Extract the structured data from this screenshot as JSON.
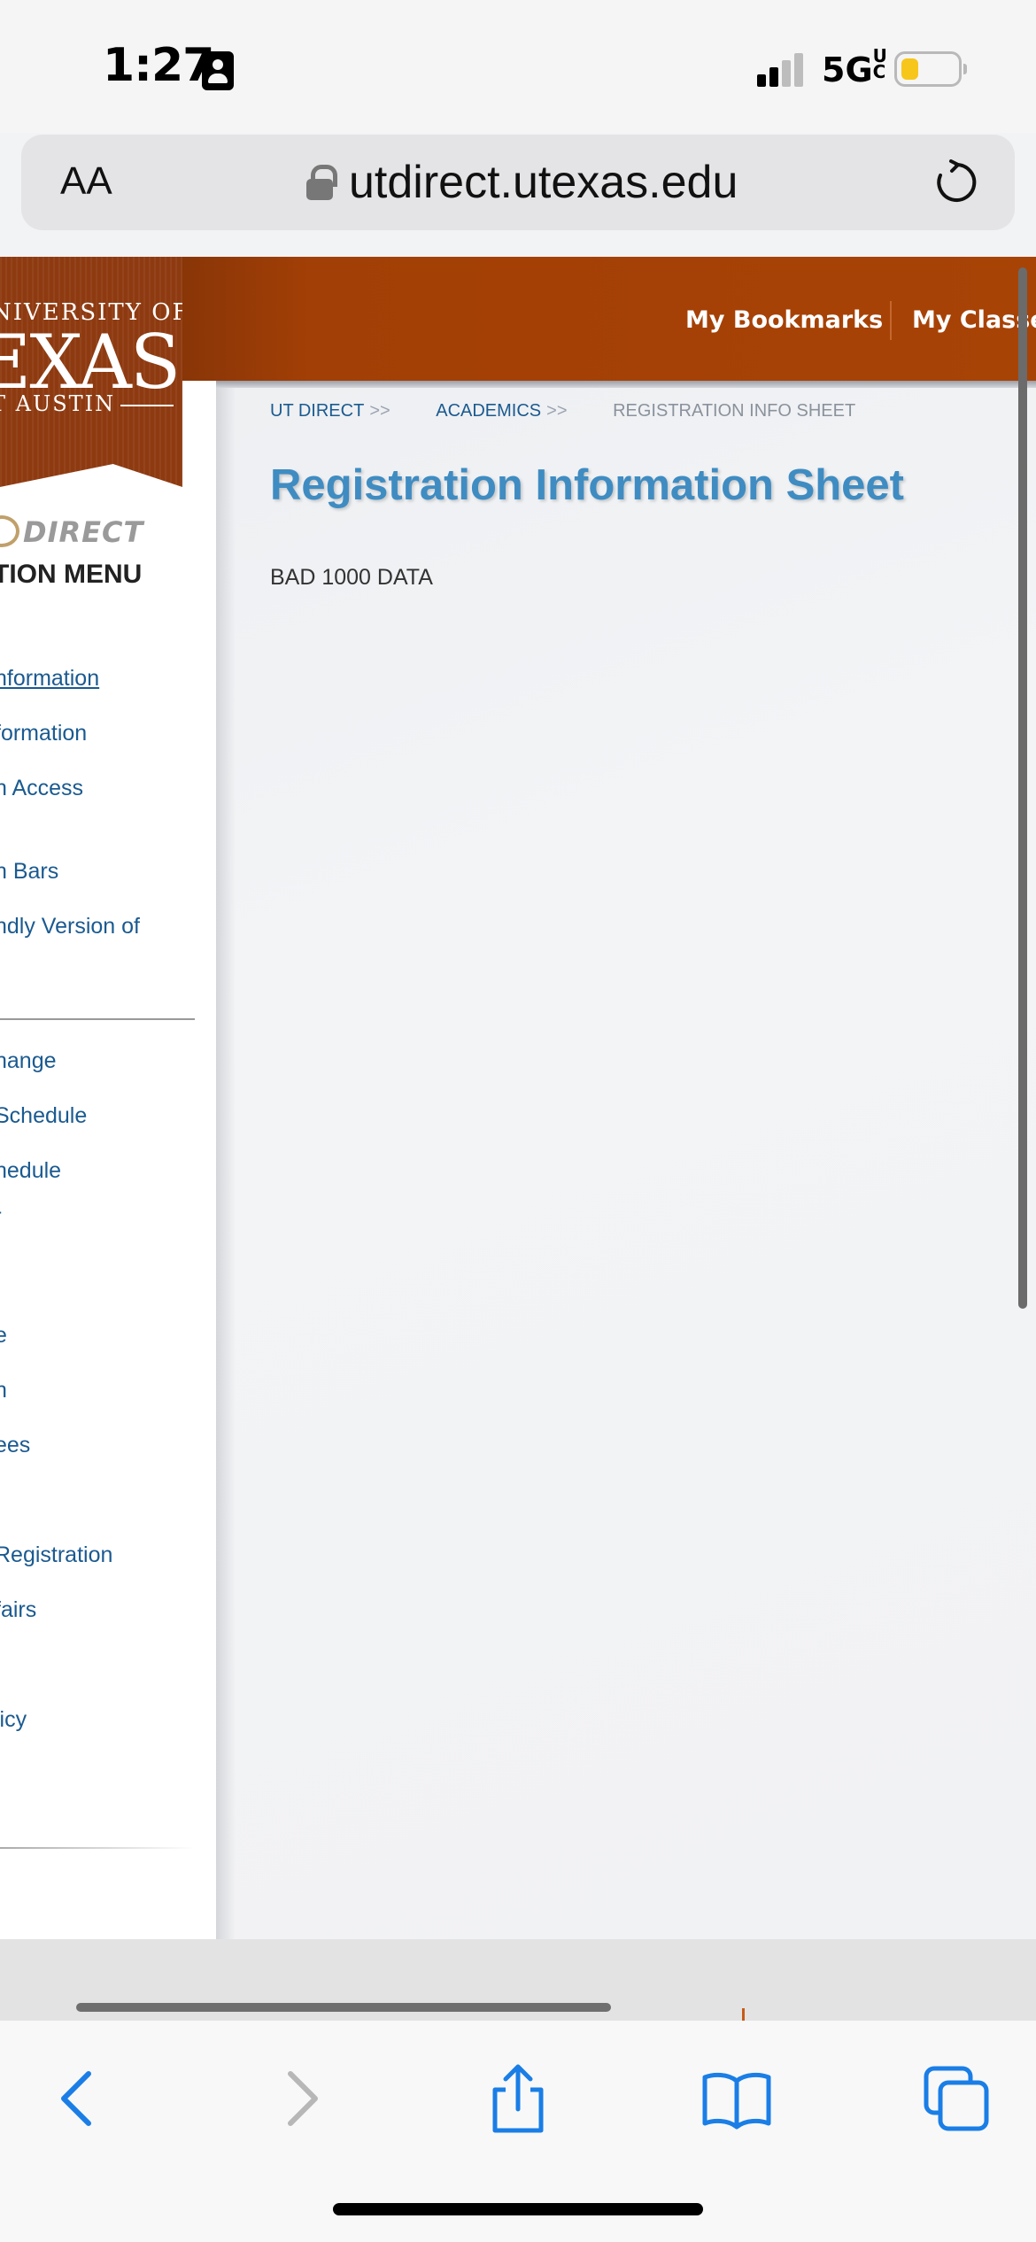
{
  "status_bar": {
    "time": "1:27",
    "network": "5G",
    "network_suffix": "UC",
    "battery_level": 0.3,
    "battery_color": "#f7c61a"
  },
  "browser": {
    "text_size_label": "AA",
    "url": "utdirect.utexas.edu",
    "icons": {
      "lock": "lock-icon",
      "reload": "reload-icon",
      "back": "back-chevron-icon",
      "forward": "forward-chevron-icon",
      "share": "share-icon",
      "bookmarks": "bookmarks-book-icon",
      "tabs": "tabs-icon"
    },
    "accent": "#1a7ee6"
  },
  "header": {
    "logo": {
      "line1": "NIVERSITY OF",
      "line2": "EXAS",
      "line3": "T AUSTIN"
    },
    "nav": [
      "My Bookmarks",
      "My Classe"
    ],
    "brand_color": "#a84306"
  },
  "sidebar": {
    "logo_text": "DIRECT",
    "menu_title": "TION MENU",
    "group1": [
      "nformation",
      "formation",
      "n Access",
      "n Bars",
      "ndly Version of"
    ],
    "group2": [
      "hange",
      "Schedule",
      "hedule",
      "-",
      "e",
      "n",
      "ees",
      "Registration",
      "fairs",
      "licy"
    ]
  },
  "main": {
    "breadcrumb": {
      "items": [
        "UT DIRECT",
        "ACADEMICS"
      ],
      "separator": ">>",
      "current": "REGISTRATION INFO SHEET"
    },
    "title": "Registration Information Sheet",
    "message": "BAD 1000 DATA",
    "title_color": "#3f8cc2"
  }
}
